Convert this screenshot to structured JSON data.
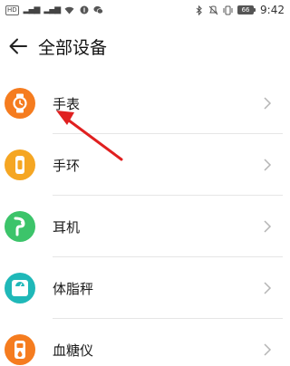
{
  "status_bar": {
    "hd_badge": "HD",
    "signal_text": "4G",
    "battery_level": "66",
    "time": "9:42"
  },
  "header": {
    "title": "全部设备"
  },
  "devices": [
    {
      "label": "手表",
      "icon": "watch-icon",
      "color": "#f57c1f"
    },
    {
      "label": "手环",
      "icon": "band-icon",
      "color": "#f5a623"
    },
    {
      "label": "耳机",
      "icon": "earphone-icon",
      "color": "#3cc46a"
    },
    {
      "label": "体脂秤",
      "icon": "scale-icon",
      "color": "#1fb8b8"
    },
    {
      "label": "血糖仪",
      "icon": "glucose-meter-icon",
      "color": "#f57c1f"
    }
  ],
  "colors": {
    "annotation_arrow": "#e02020",
    "chevron": "#b5b5b5",
    "divider": "#e6e6e6"
  }
}
